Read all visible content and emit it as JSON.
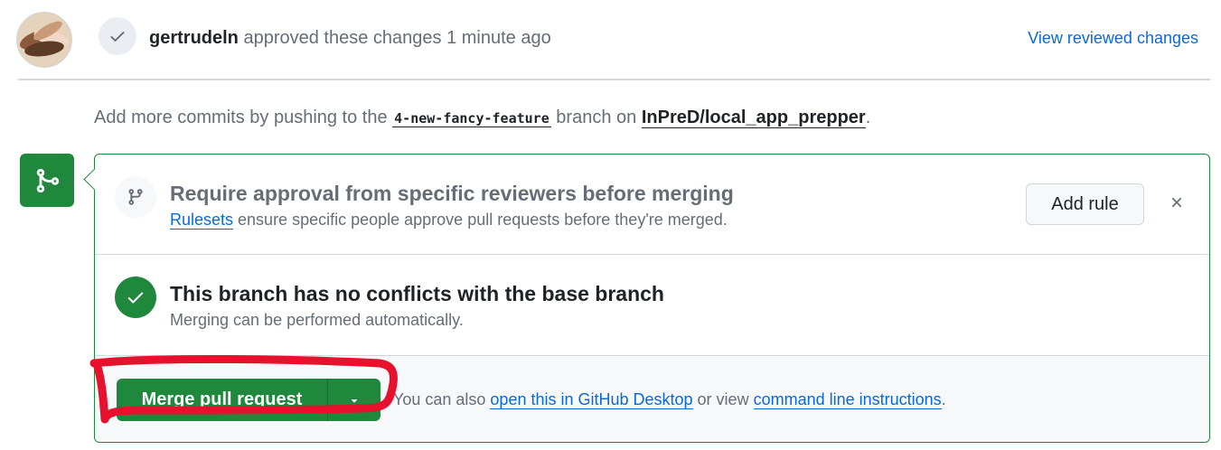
{
  "review": {
    "username": "gertrudeln",
    "action_text": " approved these changes 1 minute ago",
    "view_reviewed_changes": "View reviewed changes"
  },
  "push_hint": {
    "prefix": "Add more commits by pushing to the ",
    "branch": "4-new-fancy-feature",
    "middle": " branch on ",
    "repo": "InPreD/local_app_prepper",
    "suffix": "."
  },
  "ruleset_notice": {
    "title": "Require approval from specific reviewers before merging",
    "link": "Rulesets",
    "desc": " ensure specific people approve pull requests before they're merged.",
    "add_rule_label": "Add rule"
  },
  "conflict_status": {
    "title": "This branch has no conflicts with the base branch",
    "desc": "Merging can be performed automatically."
  },
  "merge_footer": {
    "merge_button_label": "Merge pull request",
    "alt_prefix": "You can also ",
    "desktop_link": "open this in GitHub Desktop",
    "alt_middle": " or view ",
    "cli_link": "command line instructions",
    "alt_suffix": "."
  },
  "colors": {
    "success_green": "#1f883d",
    "link_blue": "#0969da",
    "annotation_red": "#e8112d",
    "muted_text": "#656d76"
  },
  "icons": {
    "avatar": "avatar",
    "review_state": "check-icon",
    "merge_tile": "git-merge-icon",
    "ruleset": "git-branch-icon",
    "status": "check-circle-icon",
    "dismiss": "close-icon",
    "dropdown": "triangle-down-icon"
  }
}
